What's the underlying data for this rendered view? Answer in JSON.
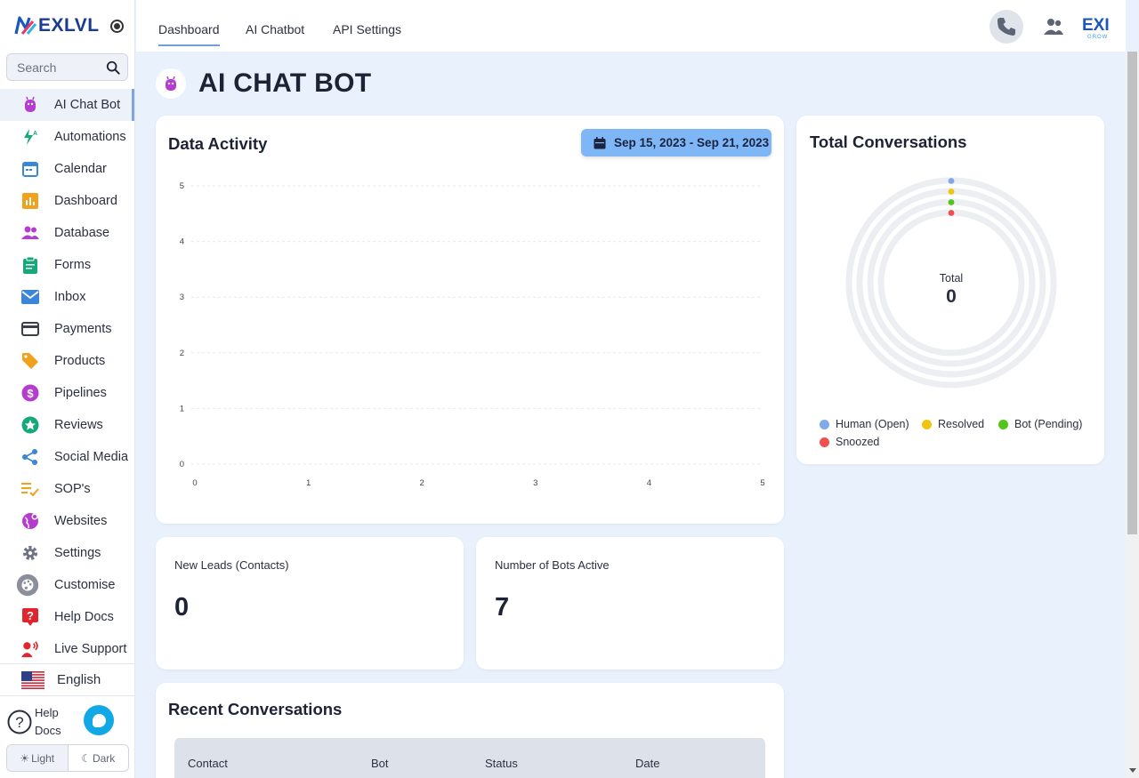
{
  "app": {
    "brand": "EXLVL",
    "search_placeholder": "Search"
  },
  "sidebar": {
    "items": [
      {
        "label": "AI Chat Bot",
        "icon": "robot-icon",
        "active": true
      },
      {
        "label": "Automations",
        "icon": "lightning-icon"
      },
      {
        "label": "Calendar",
        "icon": "calendar-icon"
      },
      {
        "label": "Dashboard",
        "icon": "bar-chart-icon"
      },
      {
        "label": "Database",
        "icon": "people-icon"
      },
      {
        "label": "Forms",
        "icon": "clipboard-icon"
      },
      {
        "label": "Inbox",
        "icon": "mail-icon"
      },
      {
        "label": "Payments",
        "icon": "credit-card-icon"
      },
      {
        "label": "Products",
        "icon": "tag-icon"
      },
      {
        "label": "Pipelines",
        "icon": "dollar-circle-icon"
      },
      {
        "label": "Reviews",
        "icon": "star-circle-icon"
      },
      {
        "label": "Social Media",
        "icon": "share-icon"
      },
      {
        "label": "SOP's",
        "icon": "checklist-icon"
      },
      {
        "label": "Websites",
        "icon": "globe-icon"
      },
      {
        "label": "Settings",
        "icon": "gear-icon"
      },
      {
        "label": "Customise",
        "icon": "palette-icon"
      },
      {
        "label": "Help Docs",
        "icon": "help-square-icon"
      },
      {
        "label": "Live Support",
        "icon": "support-agent-icon"
      }
    ],
    "language": "English",
    "help_label": "Help Docs",
    "theme_light": "Light",
    "theme_dark": "Dark"
  },
  "topbar": {
    "tabs": [
      "Dashboard",
      "AI Chatbot",
      "API Settings"
    ],
    "active_tab": "Dashboard",
    "brand_mark": "EXI",
    "brand_sub": "GROW"
  },
  "page": {
    "title": "AI CHAT BOT"
  },
  "data_activity": {
    "title": "Data Activity",
    "date_range": "Sep 15, 2023 - Sep 21, 2023"
  },
  "total_conversations": {
    "title": "Total Conversations",
    "center_label": "Total",
    "center_value": "0",
    "legend": [
      {
        "name": "Human (Open)",
        "color": "#7fa9e8"
      },
      {
        "name": "Resolved",
        "color": "#f1c40f"
      },
      {
        "name": "Bot (Pending)",
        "color": "#52c41a"
      },
      {
        "name": "Snoozed",
        "color": "#ef4f4f"
      }
    ]
  },
  "stats": {
    "new_leads_label": "New Leads (Contacts)",
    "new_leads_value": "0",
    "bots_active_label": "Number of Bots Active",
    "bots_active_value": "7"
  },
  "recent_conversations": {
    "title": "Recent Conversations",
    "columns": [
      "Contact",
      "Bot",
      "Status",
      "Date"
    ]
  },
  "chart_data": [
    {
      "type": "line",
      "title": "",
      "x": [
        0,
        1,
        2,
        3,
        4,
        5
      ],
      "series": [],
      "xlim": [
        0,
        5
      ],
      "ylim": [
        0,
        5
      ],
      "x_ticks": [
        "0",
        "1",
        "2",
        "3",
        "4",
        "5"
      ],
      "y_ticks": [
        "0",
        "1",
        "2",
        "3",
        "4",
        "5"
      ],
      "grid": true
    },
    {
      "type": "pie",
      "title": "",
      "categories": [
        "Human (Open)",
        "Resolved",
        "Bot (Pending)",
        "Snoozed"
      ],
      "values": [
        0,
        0,
        0,
        0
      ],
      "colors": [
        "#7fa9e8",
        "#f1c40f",
        "#52c41a",
        "#ef4f4f"
      ],
      "style": "concentric-radial",
      "legend": "bottom"
    }
  ]
}
